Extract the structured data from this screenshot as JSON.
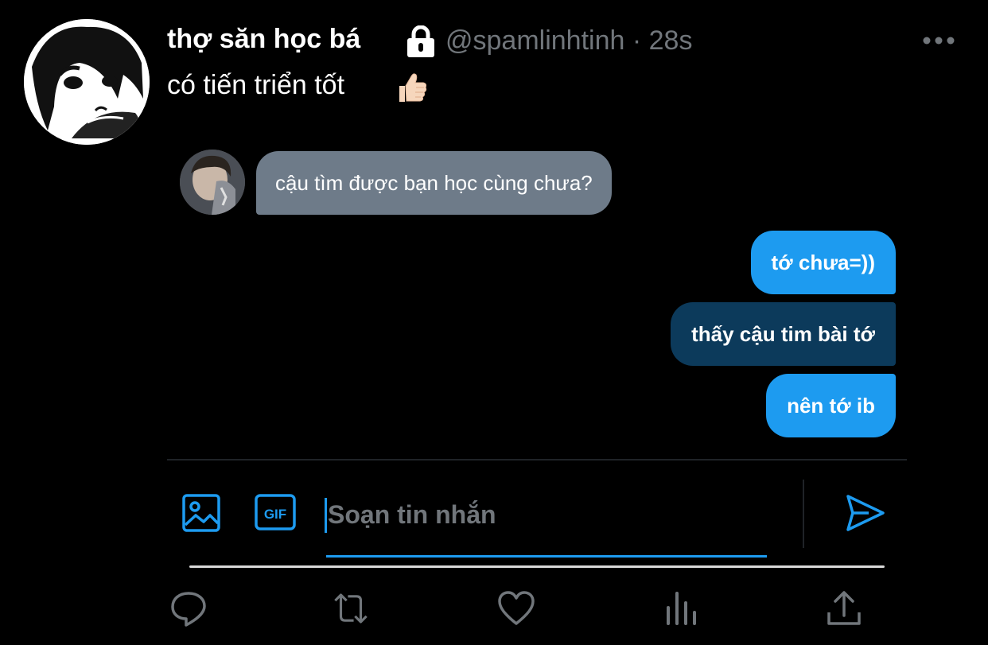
{
  "tweet": {
    "author_name": "thợ săn học bá",
    "handle": "@spamlinhtinh",
    "separator": "·",
    "time": "28s",
    "text": "có tiến triển tốt",
    "emoji": "thumbs-up"
  },
  "dm": {
    "messages": [
      {
        "direction": "incoming",
        "text": "cậu tìm được bạn học cùng chưa?"
      },
      {
        "direction": "outgoing",
        "text": "tớ chưa=))"
      },
      {
        "direction": "outgoing",
        "text": "thấy cậu tim bài tớ"
      },
      {
        "direction": "outgoing",
        "text": "nên tớ ib"
      }
    ],
    "composer": {
      "placeholder": "Soạn tin nhắn",
      "value": ""
    }
  },
  "colors": {
    "accent": "#1d9bf0",
    "incoming_bubble": "#6e7b89",
    "outgoing_dark_bubble": "#0c3a5b",
    "secondary_text": "#71767b"
  },
  "icons": {
    "more": "more-dots-icon",
    "lock": "lock-icon",
    "image": "image-icon",
    "gif": "gif-icon",
    "send": "send-icon",
    "reply": "reply-icon",
    "retweet": "retweet-icon",
    "like": "heart-icon",
    "analytics": "analytics-icon",
    "share": "share-icon"
  }
}
